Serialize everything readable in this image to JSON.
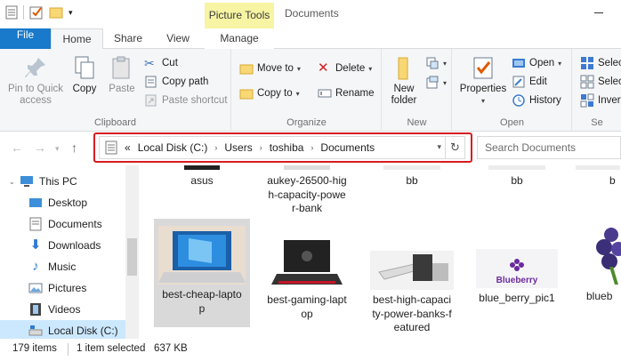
{
  "window": {
    "title": "Documents"
  },
  "context_tab": {
    "label": "Picture Tools"
  },
  "tabs": [
    {
      "label": "File"
    },
    {
      "label": "Home"
    },
    {
      "label": "Share"
    },
    {
      "label": "View"
    },
    {
      "label": "Manage"
    }
  ],
  "ribbon": {
    "clipboard": {
      "label": "Clipboard",
      "pin": "Pin to Quick access",
      "copy": "Copy",
      "paste": "Paste",
      "cut": "Cut",
      "copy_path": "Copy path",
      "paste_shortcut": "Paste shortcut"
    },
    "organize": {
      "label": "Organize",
      "move_to": "Move to",
      "copy_to": "Copy to",
      "delete": "Delete",
      "rename": "Rename"
    },
    "new": {
      "label": "New",
      "new_folder": "New folder"
    },
    "open": {
      "label": "Open",
      "properties": "Properties",
      "open": "Open",
      "edit": "Edit",
      "history": "History"
    },
    "select": {
      "label": "Se",
      "select_all": "Selec",
      "select_none": "Selec",
      "invert": "Invert"
    }
  },
  "address": {
    "prefix": "«",
    "crumbs": [
      "Local Disk (C:)",
      "Users",
      "toshiba",
      "Documents"
    ]
  },
  "search": {
    "placeholder": "Search Documents"
  },
  "nav": {
    "items": [
      {
        "label": "This PC"
      },
      {
        "label": "Desktop"
      },
      {
        "label": "Documents"
      },
      {
        "label": "Downloads"
      },
      {
        "label": "Music"
      },
      {
        "label": "Pictures"
      },
      {
        "label": "Videos"
      },
      {
        "label": "Local Disk (C:)"
      }
    ]
  },
  "files_row1": [
    {
      "l1": "asus",
      "l2": "",
      "l3": ""
    },
    {
      "l1": "aukey-26500-hig",
      "l2": "h-capacity-powe",
      "l3": "r-bank"
    },
    {
      "l1": "bb",
      "l2": "",
      "l3": ""
    },
    {
      "l1": "bb",
      "l2": "",
      "l3": ""
    },
    {
      "l1": "b",
      "l2": "",
      "l3": ""
    }
  ],
  "files_row2": [
    {
      "l1": "best-cheap-lapto",
      "l2": "p",
      "l3": ""
    },
    {
      "l1": "best-gaming-lapt",
      "l2": "op",
      "l3": ""
    },
    {
      "l1": "best-high-capaci",
      "l2": "ty-power-banks-f",
      "l3": "eatured"
    },
    {
      "l1": "blue_berry_pic1",
      "l2": "",
      "l3": ""
    },
    {
      "l1": "blueb",
      "l2": "",
      "l3": ""
    }
  ],
  "thumb_text": {
    "blueberry": "Blueberry"
  },
  "status": {
    "count": "179 items",
    "selected": "1 item selected",
    "size": "637 KB"
  },
  "colors": {
    "file_tab": "#1979ca",
    "highlight": "#d81b21",
    "context": "#f7f4a3",
    "selected": "#cce8ff"
  }
}
